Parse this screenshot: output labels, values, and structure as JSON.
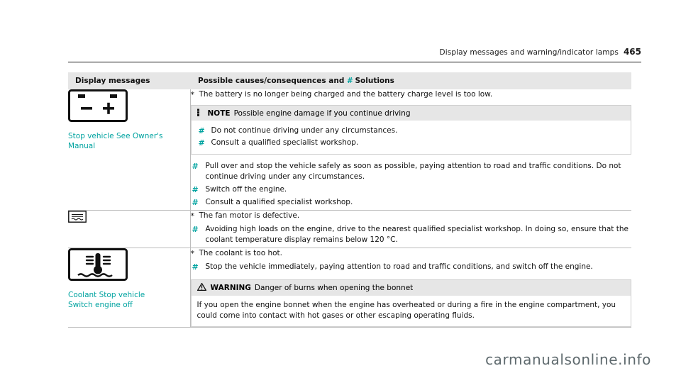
{
  "header": {
    "title": "Display messages and warning/indicator lamps",
    "page_number": "465"
  },
  "table": {
    "columns": [
      {
        "label": "Display messages"
      },
      {
        "label_a": "Possible causes/consequences and",
        "arrow": "#",
        "label_b": "Solutions"
      }
    ],
    "rows": [
      {
        "icon": "battery-charge-icon",
        "symbol_label": "Stop vehicle See Owner's\nManual",
        "cause": "The battery is no longer being charged and the battery charge level is too low.",
        "note": {
          "glyph": "asterisk-marker",
          "label": "NOTE",
          "text": "Possible engine damage if you continue driving",
          "bullets": [
            "Do not continue driving under any circumstances.",
            "Consult a qualified specialist workshop."
          ]
        },
        "bullets": [
          "Pull over and stop the vehicle safely as soon as possible, paying attention to road and traffic conditions. Do not continue driving under any circumstances.",
          "Switch off the engine.",
          "Consult a qualified specialist workshop."
        ]
      },
      {
        "icon": "fan-motor-icon",
        "symbol_label": "",
        "cause": "The fan motor is defective.",
        "bullets": [
          "Avoiding high loads on the engine, drive to the nearest qualified specialist workshop. In doing so, ensure that the coolant temperature display remains below 120 °C."
        ]
      },
      {
        "icon": "coolant-temperature-icon",
        "symbol_label": "Coolant Stop vehicle\nSwitch engine off",
        "cause": "The coolant is too hot.",
        "bullets": [
          "Stop the vehicle immediately, paying attention to road and traffic conditions, and switch off the engine."
        ],
        "warning": {
          "glyph": "warning-triangle",
          "label": "WARNING",
          "text": "Danger of burns when opening the bonnet",
          "body": "If you open the engine bonnet when the engine has overheated or during a fire in the engine compartment, you could come into contact with hot gases or other escaping operating fluids."
        }
      }
    ]
  },
  "watermark": "carmanualsonline.info",
  "colors": {
    "accent": "#00a3a0",
    "header_bg": "#e6e6e6",
    "rule": "#bdbdbd"
  }
}
